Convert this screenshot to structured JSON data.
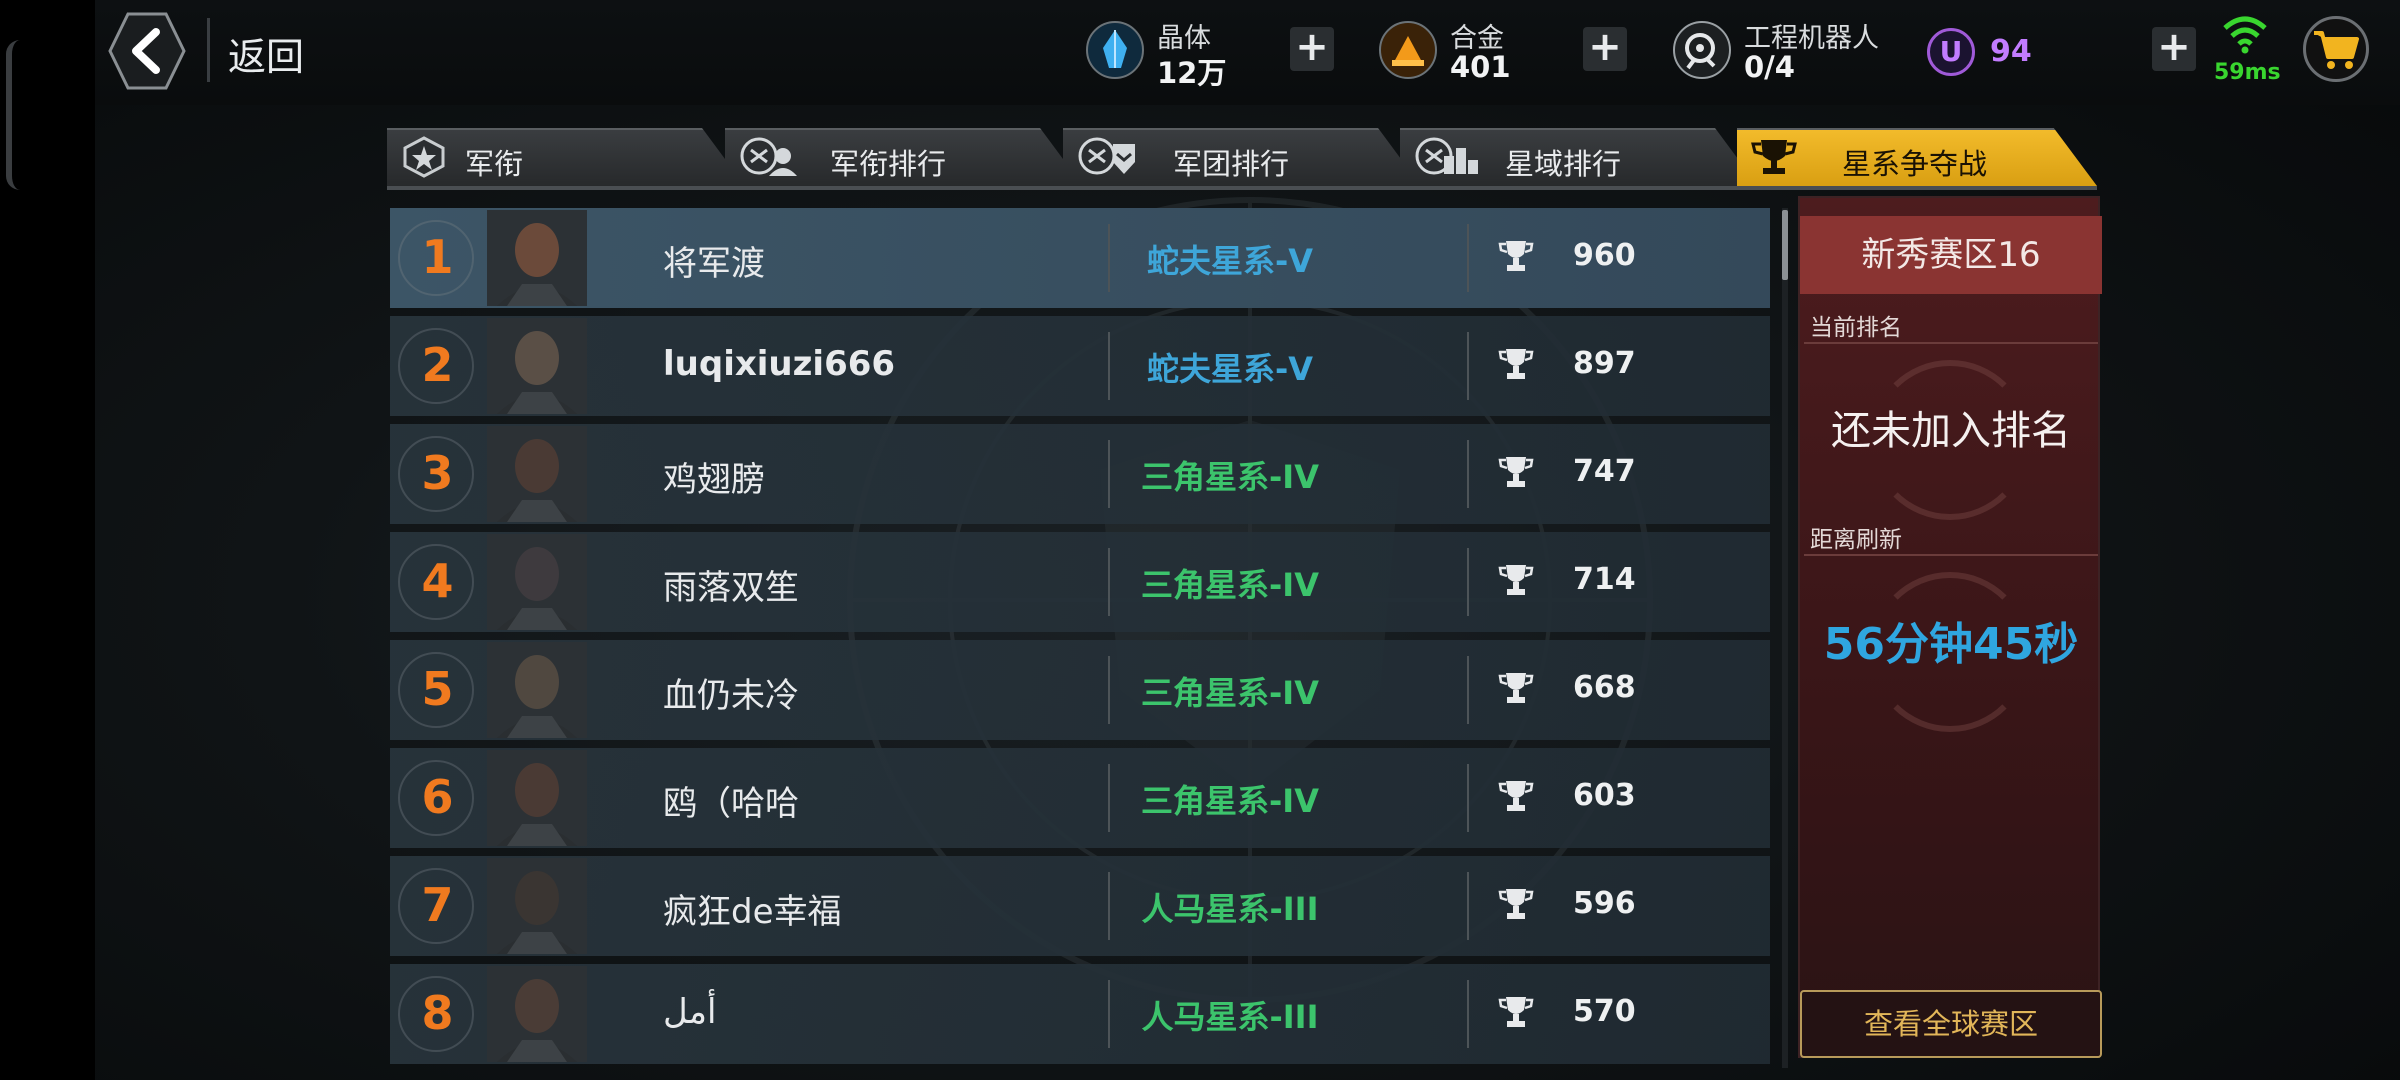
{
  "header": {
    "back_label": "返回",
    "resources": [
      {
        "name": "晶体",
        "value": "12万",
        "icon": "crystal-icon"
      },
      {
        "name": "合金",
        "value": "401",
        "icon": "alloy-icon"
      },
      {
        "name": "工程机器人",
        "value": "0/4",
        "icon": "robot-icon"
      }
    ],
    "u_badge": "U",
    "u_value": "94",
    "ping": "59ms"
  },
  "tabs": [
    {
      "label": "军衔",
      "icon": "rank-badge-icon",
      "active": false
    },
    {
      "label": "军衔排行",
      "icon": "rank-leaderboard-icon",
      "active": false
    },
    {
      "label": "军团排行",
      "icon": "legion-leaderboard-icon",
      "active": false
    },
    {
      "label": "星域排行",
      "icon": "star-domain-leaderboard-icon",
      "active": false
    },
    {
      "label": "星系争夺战",
      "icon": "trophy-icon",
      "active": true
    }
  ],
  "leaderboard": [
    {
      "rank": "1",
      "name": "将军渡",
      "galaxy": "蛇夫星系-V",
      "galaxy_color": "#3ea6d9",
      "score": "960"
    },
    {
      "rank": "2",
      "name": "luqixiuzi666",
      "galaxy": "蛇夫星系-V",
      "galaxy_color": "#3ea6d9",
      "score": "897"
    },
    {
      "rank": "3",
      "name": "鸡翅膀",
      "galaxy": "三角星系-IV",
      "galaxy_color": "#3cc46c",
      "score": "747"
    },
    {
      "rank": "4",
      "name": "雨落双笙",
      "galaxy": "三角星系-IV",
      "galaxy_color": "#3cc46c",
      "score": "714"
    },
    {
      "rank": "5",
      "name": "血仍未冷",
      "galaxy": "三角星系-IV",
      "galaxy_color": "#3cc46c",
      "score": "668"
    },
    {
      "rank": "6",
      "name": "鸥（哈哈",
      "galaxy": "三角星系-IV",
      "galaxy_color": "#3cc46c",
      "score": "603"
    },
    {
      "rank": "7",
      "name": "疯狂de幸福",
      "galaxy": "人马星系-III",
      "galaxy_color": "#3cc46c",
      "score": "596"
    },
    {
      "rank": "8",
      "name": "أمل",
      "galaxy": "人马星系-III",
      "galaxy_color": "#3cc46c",
      "score": "570"
    }
  ],
  "side": {
    "zone": "新秀赛区16",
    "current_rank_label": "当前排名",
    "current_rank_status": "还未加入排名",
    "refresh_label": "距离刷新",
    "refresh_time": "56分钟45秒",
    "global_button": "查看全球赛区"
  },
  "colors": {
    "accent_tab": "#f2bb2b",
    "rank_number": "#f07a1f",
    "timer": "#2fa6e0",
    "u_currency": "#c27cff"
  }
}
